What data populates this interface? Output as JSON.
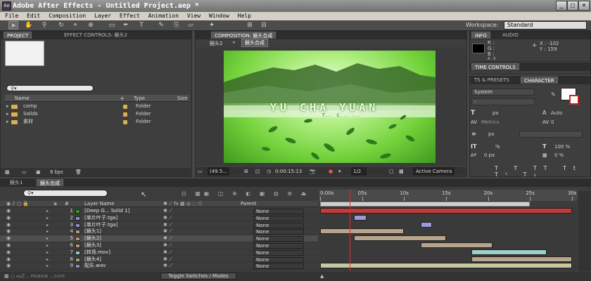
{
  "window": {
    "title": "Adobe After Effects - Untitled Project.aep *",
    "app_icon": "Ae"
  },
  "menu": [
    "File",
    "Edit",
    "Composition",
    "Layer",
    "Effect",
    "Animation",
    "View",
    "Window",
    "Help"
  ],
  "workspace": {
    "label": "Workspace:",
    "value": "Standard"
  },
  "project_panel": {
    "tabs": [
      "PROJECT",
      "EFFECT CONTROLS: 鏡头2"
    ],
    "columns": {
      "name": "Name",
      "type": "Type",
      "size": "Size"
    },
    "items": [
      {
        "name": "comp",
        "type": "Folder"
      },
      {
        "name": "Solids",
        "type": "Folder"
      },
      {
        "name": "素材",
        "type": "Folder"
      }
    ],
    "bpc": "8 bpc"
  },
  "composition_panel": {
    "tab": "COMPOSITION: 鏡头合成",
    "breadcrumbs": [
      "鏡头2",
      "鏡头合成"
    ],
    "footer": {
      "zoom": "(49.5...",
      "timecode": "0:00:15:13",
      "resolution": "1/2",
      "camera": "Active Camera"
    },
    "frame": {
      "title": "YU CHA YUAN",
      "subtitle": "T... C... ..."
    }
  },
  "info_panel": {
    "tabs": [
      "INFO",
      "AUDIO"
    ],
    "r": "R :",
    "g": "G :",
    "b": "B :",
    "a": "A : 0",
    "x": "X : -102",
    "y": "Y : 159"
  },
  "time_controls": {
    "tab": "TIME CONTROLS"
  },
  "character_panel": {
    "tabs": [
      "TS & PRESETS",
      "CHARACTER"
    ],
    "font": "System",
    "size_unit": "px",
    "leading": "Auto",
    "kerning": "Metrics",
    "tracking": "0",
    "stroke_unit": "px",
    "vscale_unit": "%",
    "hscale": "100 %",
    "baseline": "0 px",
    "tsume": "0 %"
  },
  "timeline": {
    "tabs": [
      "鏡头1",
      "鏡头合成"
    ],
    "columns": {
      "num": "#",
      "layer_name": "Layer Name",
      "parent": "Parent"
    },
    "ruler": [
      "0:00s",
      "05s",
      "10s",
      "15s",
      "20s",
      "25s",
      "30s"
    ],
    "layers": [
      {
        "num": "1",
        "name": "[Deep G... Solid 1]",
        "color": "#2a9a2a",
        "parent": "None",
        "bar": {
          "start": 0,
          "end": 30
        },
        "bar_color": "#c33a3a"
      },
      {
        "num": "2",
        "name": "[单片叶子.tga]",
        "color": "#8f8fc8",
        "parent": "None",
        "bar": {
          "start": 4,
          "end": 5.5
        },
        "bar_color": "#9a9ad8"
      },
      {
        "num": "3",
        "name": "[单片叶子.tga]",
        "color": "#8f8fc8",
        "parent": "None",
        "bar": {
          "start": 12,
          "end": 13.3
        },
        "bar_color": "#9a9ad8"
      },
      {
        "num": "4",
        "name": "[鏡头1]",
        "color": "#b39a7c",
        "parent": "None",
        "bar": {
          "start": 0,
          "end": 10
        },
        "bar_color": "#b8a48a"
      },
      {
        "num": "5",
        "name": "[鏡头2]",
        "color": "#b39a7c",
        "parent": "None",
        "bar": {
          "start": 4,
          "end": 15
        },
        "bar_color": "#b8a48a"
      },
      {
        "num": "6",
        "name": "[鏡头3]",
        "color": "#b39a7c",
        "parent": "None",
        "bar": {
          "start": 12,
          "end": 20.5
        },
        "bar_color": "#b8a48a"
      },
      {
        "num": "7",
        "name": "[转场.mov]",
        "color": "#8fc8c0",
        "parent": "None",
        "bar": {
          "start": 18,
          "end": 27
        },
        "bar_color": "#9ed0c8"
      },
      {
        "num": "8",
        "name": "[鏡头4]",
        "color": "#b39a7c",
        "parent": "None",
        "bar": {
          "start": 18,
          "end": 30
        },
        "bar_color": "#b8a48a"
      },
      {
        "num": "9",
        "name": "配乐.wav",
        "color": "#8f8fc8",
        "parent": "None",
        "bar": {
          "start": 0,
          "end": 30
        },
        "bar_color": "#c8c8a0"
      }
    ],
    "toggle_label": "Toggle Switches / Modes",
    "current_time": 3.5,
    "work_area": [
      0,
      25
    ]
  },
  "watermark": "Z... Huaxia ...com"
}
